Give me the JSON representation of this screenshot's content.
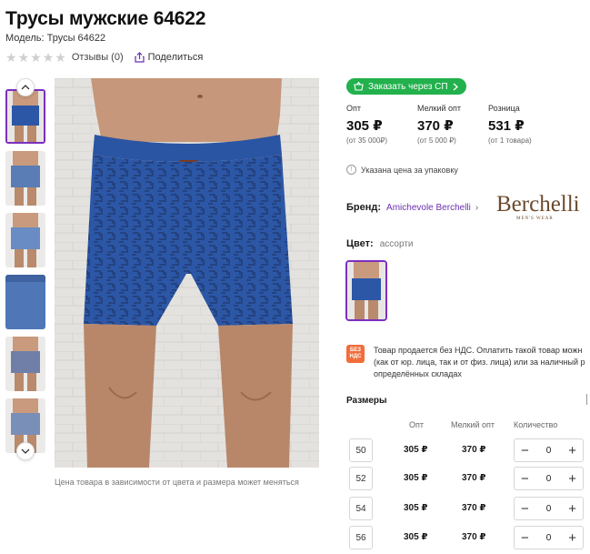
{
  "product": {
    "title": "Трусы мужские 64622",
    "model": "Модель: Трусы 64622",
    "reviews": "Отзывы (0)",
    "share": "Поделиться"
  },
  "gallery": {
    "caption": "Цена товара в зависимости от цвета и размера может меняться"
  },
  "order_button": "Заказать через СП",
  "prices": [
    {
      "label": "Опт",
      "value": "305 ₽",
      "note": "(от 35 000₽)"
    },
    {
      "label": "Мелкий опт",
      "value": "370 ₽",
      "note": "(от 5 000 ₽)"
    },
    {
      "label": "Розница",
      "value": "531 ₽",
      "note": "(от 1 товара)"
    }
  ],
  "notice": "Указана цена за упаковку",
  "brand": {
    "label": "Бренд:",
    "name": "Amichevole Berchelli",
    "logo_text": "Berchelli",
    "logo_subtext": "MEN'S WEAR"
  },
  "color": {
    "label": "Цвет:",
    "value": "ассорти"
  },
  "nds": {
    "icon_top": "БЕЗ",
    "icon_bottom": "НДС",
    "line1": "Товар продается без НДС. Оплатить такой товар можн",
    "line2": "(как от юр. лица, так и от физ. лица) или за наличный р",
    "line3": "определённых складах"
  },
  "sizes": {
    "title": "Размеры",
    "headers": {
      "opt": "Опт",
      "small": "Мелкий опт",
      "qty": "Количество"
    },
    "rows": [
      {
        "size": "50",
        "opt": "305 ₽",
        "small": "370 ₽",
        "qty": "0"
      },
      {
        "size": "52",
        "opt": "305 ₽",
        "small": "370 ₽",
        "qty": "0"
      },
      {
        "size": "54",
        "opt": "305 ₽",
        "small": "370 ₽",
        "qty": "0"
      },
      {
        "size": "56",
        "opt": "305 ₽",
        "small": "370 ₽",
        "qty": "0"
      }
    ]
  },
  "colors": {
    "accent": "#7b2fbf",
    "order_green": "#22b14c",
    "nds_orange": "#f26d3a",
    "underwear_blue": "#2c57a6"
  }
}
